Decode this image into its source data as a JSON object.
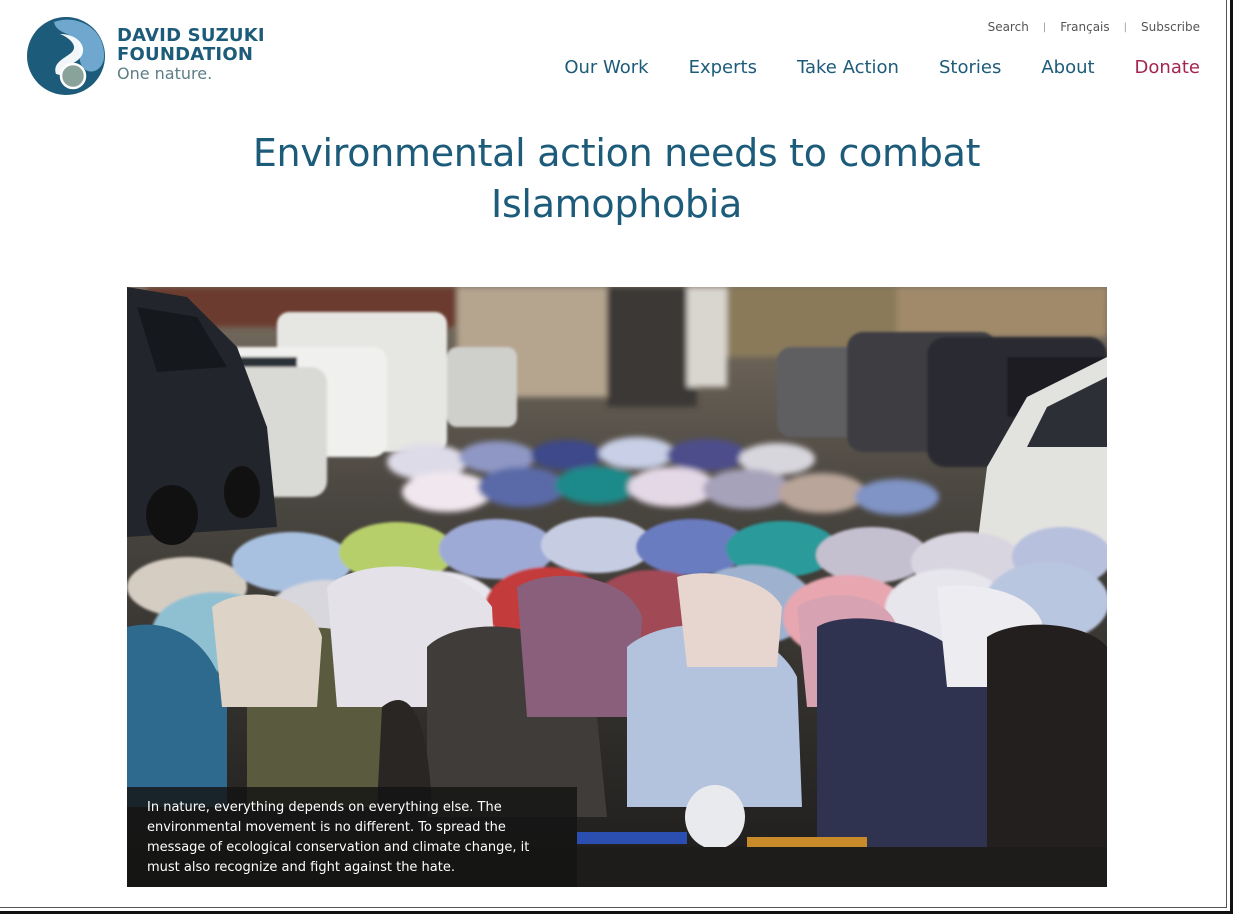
{
  "brand": {
    "line1": "DAVID SUZUKI",
    "line2": "FOUNDATION",
    "tagline": "One nature.",
    "colors": {
      "teal": "#1c5b79",
      "blue": "#6fa7cf",
      "sage": "#8aa39a",
      "accent": "#a3244d"
    }
  },
  "utility_nav": {
    "search": "Search",
    "language": "Français",
    "subscribe": "Subscribe"
  },
  "main_nav": {
    "items": [
      {
        "label": "Our Work"
      },
      {
        "label": "Experts"
      },
      {
        "label": "Take Action"
      },
      {
        "label": "Stories"
      },
      {
        "label": "About"
      }
    ],
    "donate": "Donate"
  },
  "article": {
    "title": "Environmental action needs to combat Islamophobia",
    "hero_caption": "In nature, everything depends on everything else. The environmental movement is no different. To spread the message of ecological conservation and climate change, it must also recognize and fight against the hate."
  }
}
